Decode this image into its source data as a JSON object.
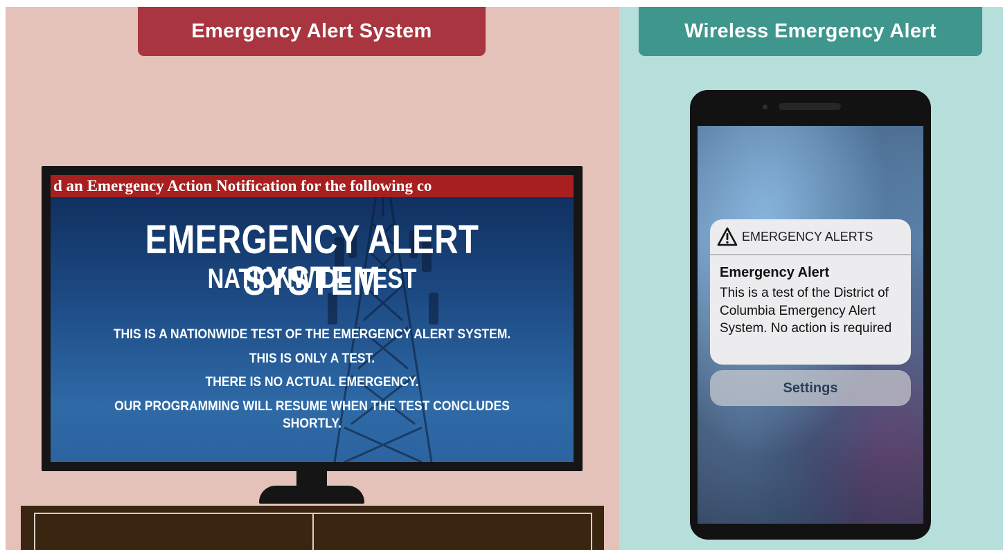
{
  "left_panel": {
    "header": "Emergency Alert System",
    "tv": {
      "crawl_text": "d an Emergency Action Notification for the following co",
      "title": "EMERGENCY ALERT SYSTEM",
      "subtitle": "NATIONWIDE TEST",
      "lines": [
        "THIS IS A NATIONWIDE TEST OF THE EMERGENCY ALERT SYSTEM.",
        "THIS IS ONLY A TEST.",
        "THERE IS NO ACTUAL EMERGENCY.",
        "OUR PROGRAMMING WILL RESUME WHEN THE TEST CONCLUDES SHORTLY."
      ]
    }
  },
  "right_panel": {
    "header": "Wireless Emergency Alert",
    "phone": {
      "alert_header": "EMERGENCY ALERTS",
      "alert_title": "Emergency Alert",
      "alert_body": "This is a test of the District of Columbia Emergency Alert System. No action is required",
      "settings_label": "Settings"
    }
  },
  "colors": {
    "left_background": "#e4c1b9",
    "right_background": "#b6dfdb",
    "eas_header": "#a8353f",
    "wea_header": "#3f968d",
    "crawl_bar": "#a81f1f"
  },
  "icons": [
    "warning-triangle-icon",
    "cell-tower-illustration"
  ]
}
